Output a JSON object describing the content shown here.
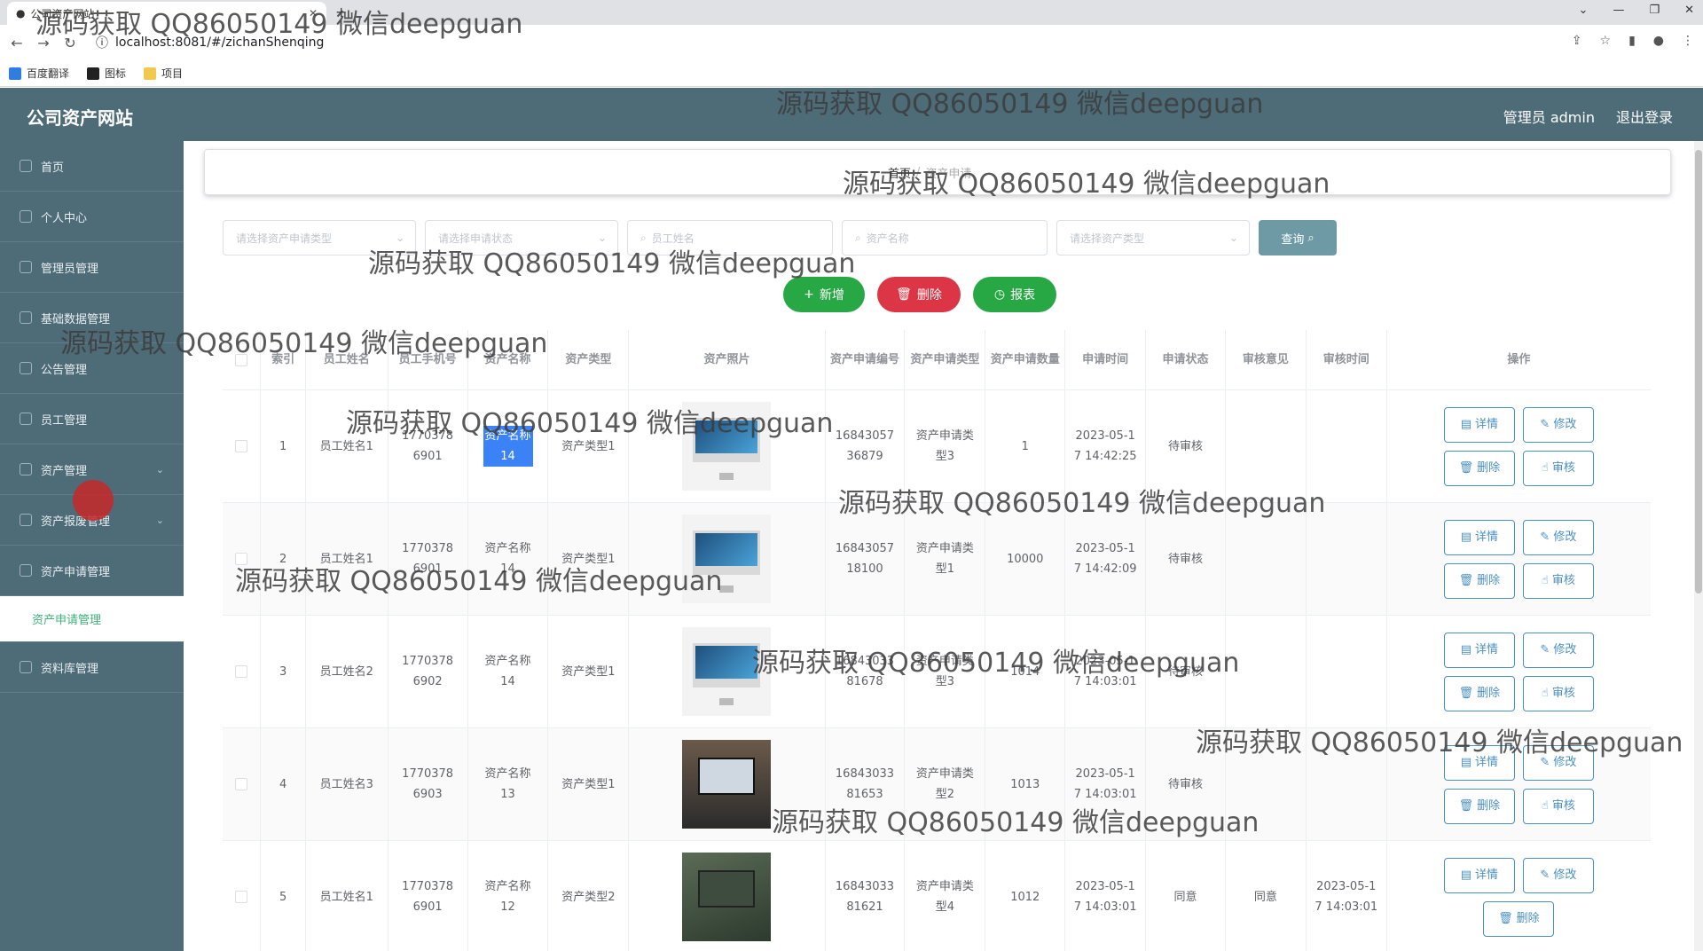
{
  "browser": {
    "tab_title": "公司资产网站",
    "url": "localhost:8081/#/zichanShenqing",
    "bookmarks": [
      "百度翻译",
      "图标",
      "项目"
    ]
  },
  "app": {
    "brand": "公司资产网站",
    "user_label": "管理员 admin",
    "logout": "退出登录"
  },
  "sidebar": {
    "items": [
      "首页",
      "个人中心",
      "管理员管理",
      "基础数据管理",
      "公告管理",
      "员工管理",
      "资产管理",
      "资产报废管理",
      "资产申请管理",
      "资产申请管理",
      "资料库管理"
    ]
  },
  "breadcrumb": {
    "home": "首页",
    "current": "资产申请"
  },
  "filters": {
    "type_placeholder": "请选择资产申请类型",
    "status_placeholder": "请选择申请状态",
    "name_placeholder": "员工姓名",
    "asset_placeholder": "资产名称",
    "assettype_placeholder": "请选择资产类型",
    "query_label": "查询"
  },
  "actions": {
    "add": "新增",
    "delete": "删除",
    "report": "报表"
  },
  "table": {
    "headers": [
      "索引",
      "员工姓名",
      "员工手机号",
      "资产名称",
      "资产类型",
      "资产照片",
      "资产申请编号",
      "资产申请类型",
      "资产申请数量",
      "申请时间",
      "申请状态",
      "审核意见",
      "审核时间",
      "操作"
    ],
    "rows": [
      {
        "idx": "1",
        "name": "员工姓名1",
        "phone": "17703786901",
        "asset": "资产名称14",
        "atype": "资产类型1",
        "no": "1684305736879",
        "rtype": "资产申请类型3",
        "qty": "1",
        "time": "2023-05-17 14:42:25",
        "status": "待审核",
        "opinion": "",
        "rtime": ""
      },
      {
        "idx": "2",
        "name": "员工姓名1",
        "phone": "17703786901",
        "asset": "资产名称14",
        "atype": "资产类型1",
        "no": "1684305718100",
        "rtype": "资产申请类型1",
        "qty": "10000",
        "time": "2023-05-17 14:42:09",
        "status": "待审核",
        "opinion": "",
        "rtime": ""
      },
      {
        "idx": "3",
        "name": "员工姓名2",
        "phone": "17703786902",
        "asset": "资产名称14",
        "atype": "资产类型1",
        "no": "1684303381678",
        "rtype": "资产申请类型3",
        "qty": "1014",
        "time": "2023-05-17 14:03:01",
        "status": "待审核",
        "opinion": "",
        "rtime": ""
      },
      {
        "idx": "4",
        "name": "员工姓名3",
        "phone": "17703786903",
        "asset": "资产名称13",
        "atype": "资产类型1",
        "no": "1684303381653",
        "rtype": "资产申请类型2",
        "qty": "1013",
        "time": "2023-05-17 14:03:01",
        "status": "待审核",
        "opinion": "",
        "rtime": ""
      },
      {
        "idx": "5",
        "name": "员工姓名1",
        "phone": "17703786901",
        "asset": "资产名称12",
        "atype": "资产类型2",
        "no": "1684303381621",
        "rtype": "资产申请类型4",
        "qty": "1012",
        "time": "2023-05-17 14:03:01",
        "status": "同意",
        "opinion": "同意",
        "rtime": "2023-05-17 14:03:01"
      }
    ],
    "op_labels": {
      "detail": "详情",
      "edit": "修改",
      "delete": "删除",
      "audit": "审核"
    }
  },
  "watermark": "源码获取 QQ86050149 微信deepguan",
  "colors": {
    "header": "#4e6b78",
    "add": "#28a745",
    "delete": "#dc3545",
    "link": "#4a90c2",
    "active": "#3db17a"
  }
}
